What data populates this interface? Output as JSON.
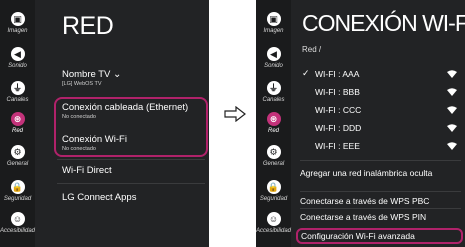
{
  "left_panel": {
    "sidebar": [
      {
        "label": "Imagen",
        "icon": "picture-icon",
        "glyph": "▣"
      },
      {
        "label": "Sonido",
        "icon": "speaker-icon",
        "glyph": "◀"
      },
      {
        "label": "Canales",
        "icon": "antenna-icon",
        "glyph": "⏚"
      },
      {
        "label": "Red",
        "icon": "network-icon",
        "glyph": "⊛"
      },
      {
        "label": "General",
        "icon": "gear-icon",
        "glyph": "⚙"
      },
      {
        "label": "Seguridad",
        "icon": "lock-icon",
        "glyph": "🔒"
      },
      {
        "label": "Accesibilidad",
        "icon": "accessibility-icon",
        "glyph": "☺"
      }
    ],
    "title": "RED",
    "tv_name_label": "Nombre TV",
    "tv_name_chevron": "⌄",
    "tv_name_value": "[LG] WebOS TV",
    "wired_label": "Conexión cableada (Ethernet)",
    "wired_status": "No conectado",
    "wifi_label": "Conexión Wi-Fi",
    "wifi_status": "No conectado",
    "wifi_direct": "Wi-Fi Direct",
    "lg_connect": "LG Connect Apps"
  },
  "right_panel": {
    "title": "CONEXIÓN WI-FI",
    "breadcrumb": "Red /",
    "networks": [
      {
        "name": "WI-FI : AAA",
        "checked": true
      },
      {
        "name": "WI-FI : BBB",
        "checked": false
      },
      {
        "name": "WI-FI : CCC",
        "checked": false
      },
      {
        "name": "WI-FI : DDD",
        "checked": false
      },
      {
        "name": "WI-FI : EEE",
        "checked": false
      }
    ],
    "check_mark": "✓",
    "add_network": "Agregar una red inalámbrica oculta",
    "wps_pbc": "Conectarse a través de WPS PBC",
    "wps_pin": "Conectarse a través de WPS PIN",
    "advanced": "Configuración Wi-Fi avanzada"
  },
  "colors": {
    "panel_bg": "#222325",
    "sidebar_bg": "#1a1b1c",
    "accent": "#b0226a",
    "active_icon": "#c3327a"
  }
}
